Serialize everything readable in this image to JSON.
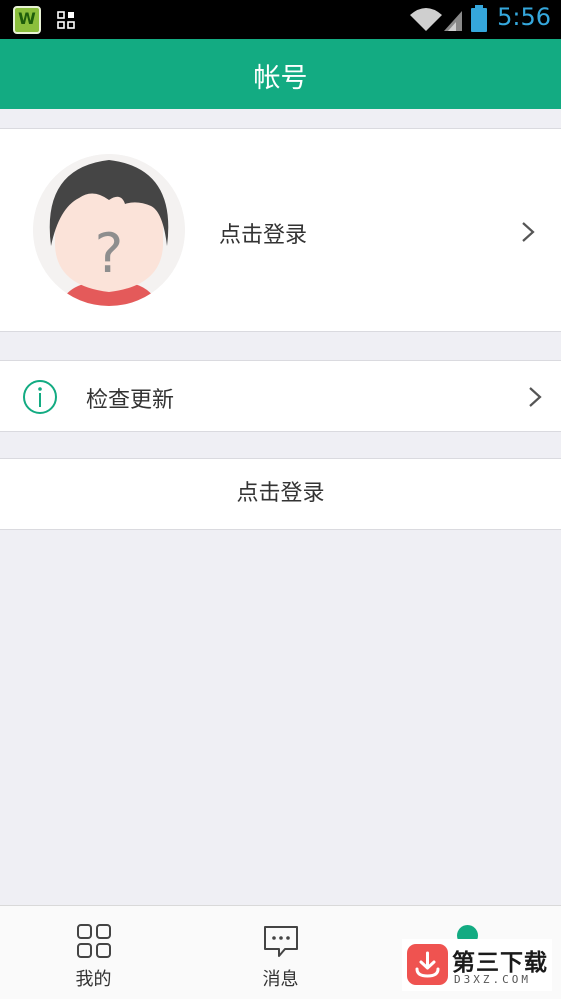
{
  "status_bar": {
    "time": "5:56",
    "app_icon_letter": "W",
    "time_color": "#35a7dc"
  },
  "header": {
    "title": "帐号",
    "background": "#13ab82"
  },
  "profile": {
    "avatar_icon": "unknown-user-avatar",
    "login_prompt": "点击登录",
    "chevron_icon": "chevron-right-icon"
  },
  "menu": {
    "check_update_label": "检查更新",
    "check_update_icon": "info-icon"
  },
  "login_button": {
    "label": "点击登录"
  },
  "tab_bar": {
    "tabs": [
      {
        "label": "我的",
        "icon": "apps-grid-icon"
      },
      {
        "label": "消息",
        "icon": "message-icon"
      },
      {
        "label": "",
        "icon": "dot-indicator"
      }
    ],
    "accent": "#13ab82"
  },
  "watermark": {
    "title": "第三下载",
    "domain": "D3XZ.COM"
  }
}
